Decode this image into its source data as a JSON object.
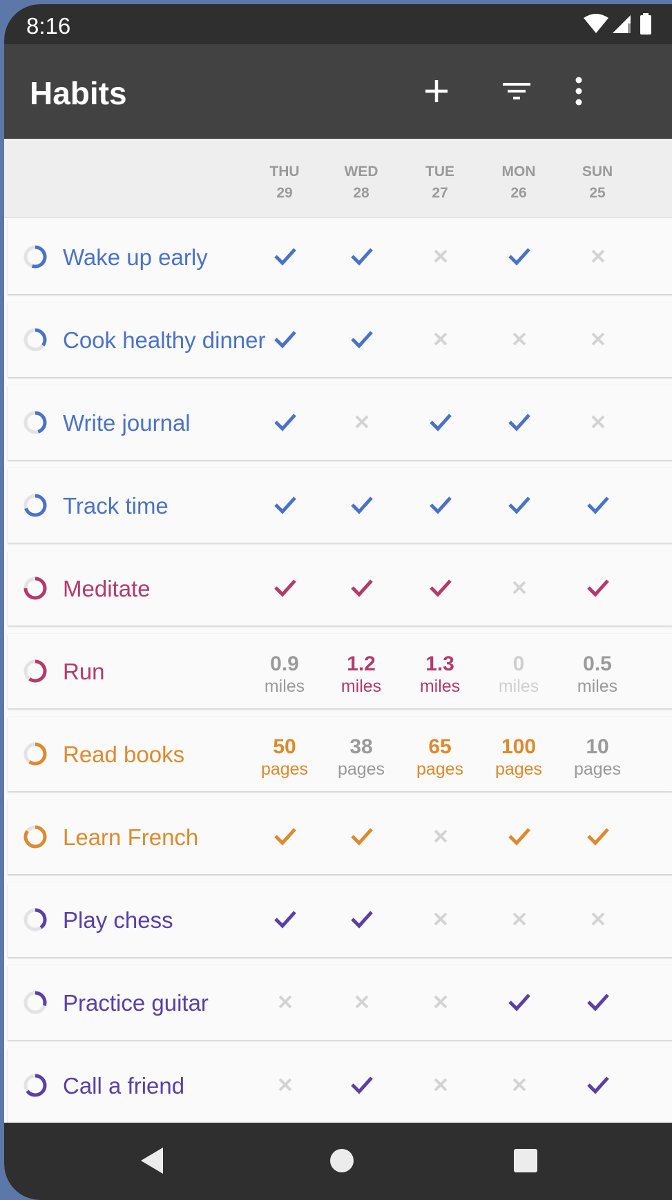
{
  "status_bar": {
    "time": "8:16"
  },
  "toolbar": {
    "title": "Habits"
  },
  "days": [
    {
      "dow": "THU",
      "date": "29"
    },
    {
      "dow": "WED",
      "date": "28"
    },
    {
      "dow": "TUE",
      "date": "27"
    },
    {
      "dow": "MON",
      "date": "26"
    },
    {
      "dow": "SUN",
      "date": "25"
    }
  ],
  "colors": {
    "blue": "#4a72c8",
    "crimson": "#b53a6b",
    "orange": "#dd8a2e",
    "purple": "#5b3ea8",
    "off": "#d3d3d3",
    "gray_value": "#9a9a9a",
    "zero_value": "#cfcfcf"
  },
  "habits": [
    {
      "name": "Wake up early",
      "color": "#4a72c8",
      "score": 0.55,
      "type": "bool",
      "cells": [
        "check",
        "check",
        "x",
        "check",
        "x"
      ]
    },
    {
      "name": "Cook healthy dinner",
      "color": "#4a72c8",
      "score": 0.35,
      "type": "bool",
      "cells": [
        "check",
        "check",
        "x",
        "x",
        "x"
      ]
    },
    {
      "name": "Write journal",
      "color": "#4a72c8",
      "score": 0.45,
      "type": "bool",
      "cells": [
        "check",
        "x",
        "check",
        "check",
        "x"
      ]
    },
    {
      "name": "Track time",
      "color": "#4a72c8",
      "score": 0.7,
      "type": "bool",
      "cells": [
        "check",
        "check",
        "check",
        "check",
        "check"
      ]
    },
    {
      "name": "Meditate",
      "color": "#b53a6b",
      "score": 0.75,
      "type": "bool",
      "cells": [
        "check",
        "check",
        "check",
        "x",
        "check"
      ]
    },
    {
      "name": "Run",
      "color": "#b53a6b",
      "score": 0.6,
      "type": "numeric",
      "cells": [
        {
          "value": "0.9",
          "unit": "miles",
          "state": "partial"
        },
        {
          "value": "1.2",
          "unit": "miles",
          "state": "met"
        },
        {
          "value": "1.3",
          "unit": "miles",
          "state": "met"
        },
        {
          "value": "0",
          "unit": "miles",
          "state": "zero"
        },
        {
          "value": "0.5",
          "unit": "miles",
          "state": "partial"
        }
      ]
    },
    {
      "name": "Read books",
      "color": "#dd8a2e",
      "score": 0.6,
      "type": "numeric",
      "cells": [
        {
          "value": "50",
          "unit": "pages",
          "state": "met"
        },
        {
          "value": "38",
          "unit": "pages",
          "state": "partial"
        },
        {
          "value": "65",
          "unit": "pages",
          "state": "met"
        },
        {
          "value": "100",
          "unit": "pages",
          "state": "met"
        },
        {
          "value": "10",
          "unit": "pages",
          "state": "partial"
        }
      ]
    },
    {
      "name": "Learn French",
      "color": "#dd8a2e",
      "score": 0.85,
      "type": "bool",
      "cells": [
        "check",
        "check",
        "x",
        "check",
        "check"
      ]
    },
    {
      "name": "Play chess",
      "color": "#5b3ea8",
      "score": 0.4,
      "type": "bool",
      "cells": [
        "check",
        "check",
        "x",
        "x",
        "x"
      ]
    },
    {
      "name": "Practice guitar",
      "color": "#5b3ea8",
      "score": 0.3,
      "type": "bool",
      "cells": [
        "x",
        "x",
        "x",
        "check",
        "check"
      ]
    },
    {
      "name": "Call a friend",
      "color": "#5b3ea8",
      "score": 0.65,
      "type": "bool",
      "cells": [
        "x",
        "check",
        "x",
        "x",
        "check"
      ]
    }
  ]
}
